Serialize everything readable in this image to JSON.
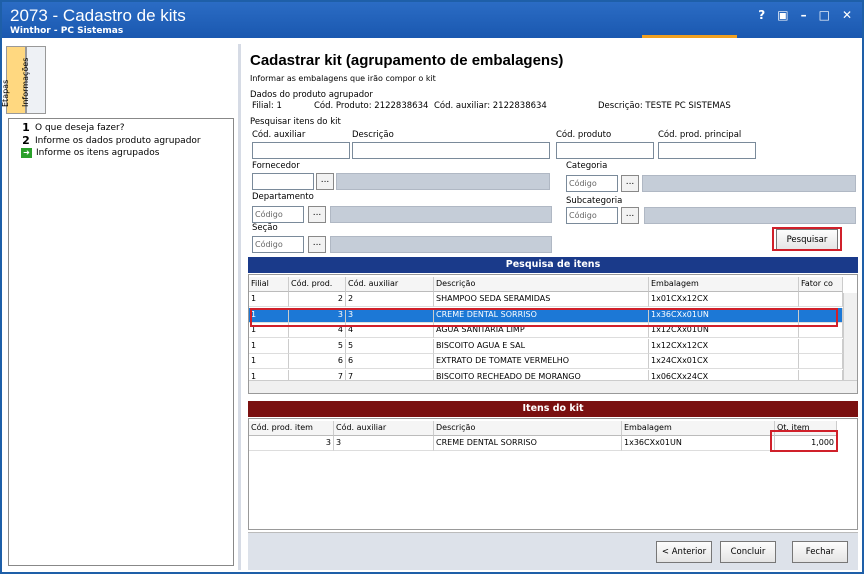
{
  "window": {
    "title": "2073 - Cadastro de kits",
    "subtitle": "Winthor - PC Sistemas",
    "controls": [
      "?",
      "▣",
      "–",
      "□",
      "✕"
    ]
  },
  "side_tabs": [
    "Etapas",
    "Informações"
  ],
  "steps": [
    {
      "num": "1",
      "label": "O que deseja fazer?",
      "icon": ""
    },
    {
      "num": "2",
      "label": "Informe os dados produto agrupador",
      "icon": ""
    },
    {
      "num": "",
      "label": "Informe os itens agrupados",
      "icon": "green-arrow-icon"
    }
  ],
  "page": {
    "title": "Cadastrar kit (agrupamento de embalagens)",
    "subtitle": "Informar as embalagens que irão compor o kit"
  },
  "agrupador": {
    "group_label": "Dados do produto agrupador",
    "filial": "Filial: 1",
    "cod_produto": "Cód. Produto: 2122838634",
    "cod_auxiliar": "Cód. auxiliar: 2122838634",
    "descricao": "Descrição: TESTE PC SISTEMAS"
  },
  "search": {
    "group_label": "Pesquisar itens do kit",
    "cod_auxiliar": "Cód. auxiliar",
    "descricao": "Descrição",
    "cod_produto": "Cód. produto",
    "cod_prod_principal": "Cód. prod. principal",
    "fornecedor": "Fornecedor",
    "categoria": "Categoria",
    "departamento": "Departamento",
    "subcategoria": "Subcategoria",
    "secao": "Seção",
    "codigo_placeholder": "Código",
    "dots": "...",
    "pesquisar": "Pesquisar"
  },
  "pesquisa_grid": {
    "title": "Pesquisa de itens",
    "columns": [
      "Filial",
      "Cód. prod.",
      "Cód. auxiliar",
      "Descrição",
      "Embalagem",
      "Fator co"
    ],
    "rows": [
      [
        "1",
        "2",
        "2",
        "SHAMPOO SEDA SERAMIDAS",
        "1x01CXx12CX",
        ""
      ],
      [
        "1",
        "3",
        "3",
        "CREME DENTAL SORRISO",
        "1x36CXx01UN",
        ""
      ],
      [
        "1",
        "4",
        "4",
        "AGUA SANITARIA LIMP",
        "1x12CXx01UN",
        ""
      ],
      [
        "1",
        "5",
        "5",
        "BISCOITO AGUA E SAL",
        "1x12CXx12CX",
        ""
      ],
      [
        "1",
        "6",
        "6",
        "EXTRATO DE TOMATE VERMELHO",
        "1x24CXx01CX",
        ""
      ],
      [
        "1",
        "7",
        "7",
        "BISCOITO RECHEADO DE MORANGO",
        "1x06CXx24CX",
        ""
      ]
    ],
    "selected_index": 1
  },
  "kit_grid": {
    "title": "Itens do kit",
    "columns": [
      "Cód. prod. item",
      "Cód. auxiliar",
      "Descrição",
      "Embalagem",
      "Qt. item"
    ],
    "rows": [
      [
        "3",
        "3",
        "CREME DENTAL SORRISO",
        "1x36CXx01UN",
        "1,000"
      ]
    ]
  },
  "buttons": {
    "anterior": "< Anterior",
    "concluir": "Concluir",
    "fechar": "Fechar"
  },
  "colors": {
    "titlebar": "#1a58b0",
    "grid_header_blue": "#1a3a8a",
    "grid_header_red": "#7a1010",
    "selection": "#1c78d6",
    "highlight": "#d0202a"
  }
}
